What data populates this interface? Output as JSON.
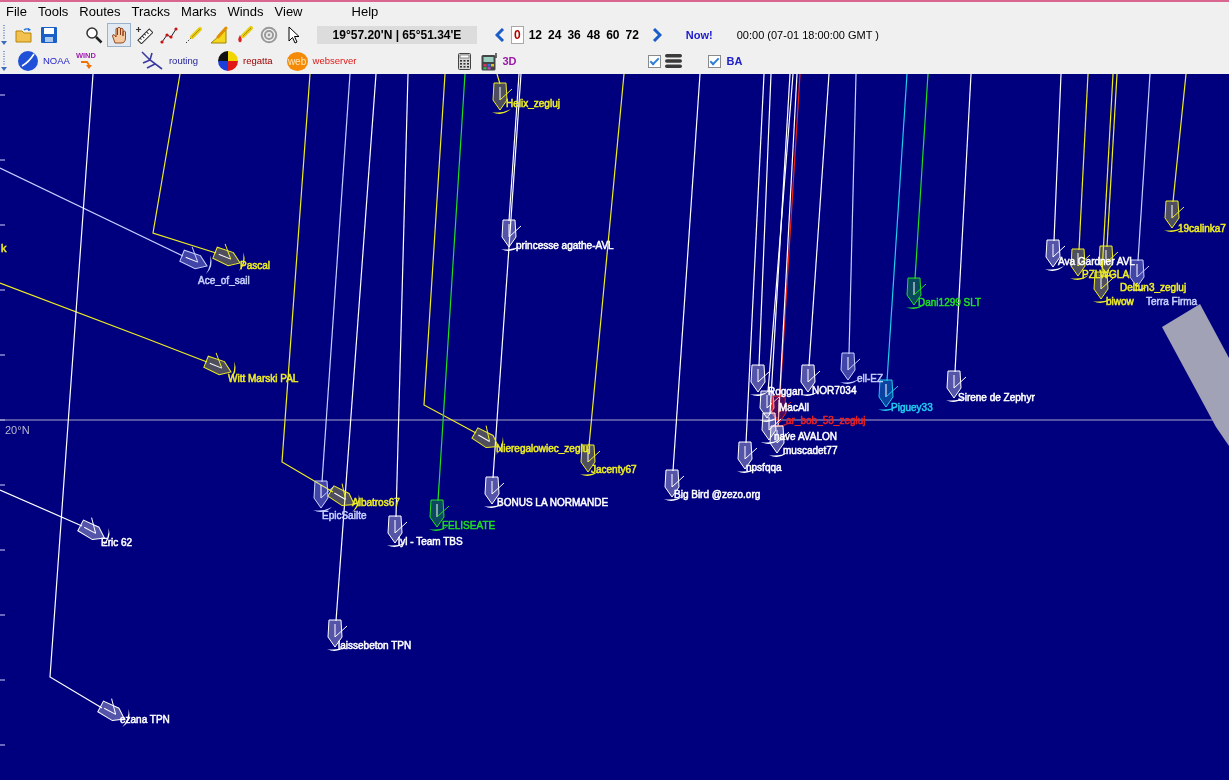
{
  "menu": [
    "File",
    "Tools",
    "Routes",
    "Tracks",
    "Marks",
    "Winds",
    "View",
    "Help"
  ],
  "toolbar": {
    "tools": [
      {
        "kind": "open",
        "selected": false
      },
      {
        "kind": "save",
        "selected": false
      },
      {
        "kind": "zoom",
        "selected": false
      },
      {
        "kind": "pan",
        "selected": true
      },
      {
        "kind": "measure",
        "selected": false
      },
      {
        "kind": "route",
        "selected": false
      },
      {
        "kind": "pencil",
        "selected": false
      },
      {
        "kind": "triangle",
        "selected": false
      },
      {
        "kind": "paint",
        "selected": false
      },
      {
        "kind": "target",
        "selected": false
      },
      {
        "kind": "cursor",
        "selected": false
      }
    ],
    "coordinates": "19°57.20'N | 65°51.34'E",
    "time_steps": [
      {
        "label": "0",
        "selected": true
      },
      {
        "label": "12",
        "selected": false
      },
      {
        "label": "24",
        "selected": false
      },
      {
        "label": "36",
        "selected": false
      },
      {
        "label": "48",
        "selected": false
      },
      {
        "label": "60",
        "selected": false
      },
      {
        "label": "72",
        "selected": false
      }
    ],
    "now_button": "Now!",
    "time": "00:00 (07-01 18:00:00 GMT )"
  },
  "toolbar_2": {
    "links": [
      {
        "kind": "noaa",
        "label": "NOAA"
      },
      {
        "kind": "wind",
        "label": "WIND"
      },
      {
        "kind": "routing",
        "label": "routing"
      },
      {
        "kind": "regatta",
        "label": "regatta"
      },
      {
        "kind": "webserver",
        "logo": "web",
        "label": "webserver"
      }
    ],
    "tools": [
      {
        "kind": "calculator"
      },
      {
        "kind": "device"
      },
      {
        "kind": "view",
        "label": "3D"
      }
    ],
    "checkboxes": [
      {
        "kind": "layers",
        "checked": true
      },
      {
        "kind": "ba",
        "label": "BA",
        "checked": true
      }
    ]
  },
  "map": {
    "latitude_label": "20°N",
    "boats": [
      {
        "name": "Helix_zegluj",
        "color": "#eeee22"
      },
      {
        "name": "19calinka7",
        "color": "#eeee22"
      },
      {
        "name": "k",
        "color": "#eeee22"
      },
      {
        "name": "princesse agathe-AVL",
        "color": "#ffffff"
      },
      {
        "name": "Pascal",
        "color": "#eeee22"
      },
      {
        "name": "Ava Gardner AVL",
        "color": "#ffffff"
      },
      {
        "name": "Ace_of_sail",
        "color": "#c8d0ff"
      },
      {
        "name": "PZLWGLA",
        "color": "#eeee22"
      },
      {
        "name": "Delfun3_zegluj",
        "color": "#eeee22"
      },
      {
        "name": "Dani1299 SLT",
        "color": "#22dd22"
      },
      {
        "name": "biwow",
        "color": "#eeee22"
      },
      {
        "name": "Terra Firma",
        "color": "#c8d0ff"
      },
      {
        "name": "Witt Marski PAL",
        "color": "#eeee22"
      },
      {
        "name": "ell-EZ",
        "color": "#c8d0ff"
      },
      {
        "name": "Roggan",
        "color": "#ffffff"
      },
      {
        "name": "NOR7034",
        "color": "#ffffff"
      },
      {
        "name": "Sirene de Zephyr",
        "color": "#ffffff"
      },
      {
        "name": "MacAll",
        "color": "#ffffff"
      },
      {
        "name": "Piguey33",
        "color": "#22ccee"
      },
      {
        "name": "ar_bob_53_zegluj",
        "color": "#ee2020"
      },
      {
        "name": "nave AVALON",
        "color": "#ffffff"
      },
      {
        "name": "Nieregalowiec_zegluj",
        "color": "#eeee22"
      },
      {
        "name": "muscadet77",
        "color": "#ffffff"
      },
      {
        "name": "Jacenty67",
        "color": "#eeee22"
      },
      {
        "name": "npsfqqa",
        "color": "#ffffff"
      },
      {
        "name": "Albatros67",
        "color": "#eeee22"
      },
      {
        "name": "BONUS LA NORMANDE",
        "color": "#ffffff"
      },
      {
        "name": "Big Bird @zezo.org",
        "color": "#ffffff"
      },
      {
        "name": "EpicSailte",
        "color": "#c8d0ff"
      },
      {
        "name": "FELISEATE",
        "color": "#22dd22"
      },
      {
        "name": "Eric 62",
        "color": "#ffffff"
      },
      {
        "name": "lyl - Team TBS",
        "color": "#ffffff"
      },
      {
        "name": "laissebeton TPN",
        "color": "#ffffff"
      },
      {
        "name": "ezana TPN",
        "color": "#ffffff"
      }
    ]
  }
}
